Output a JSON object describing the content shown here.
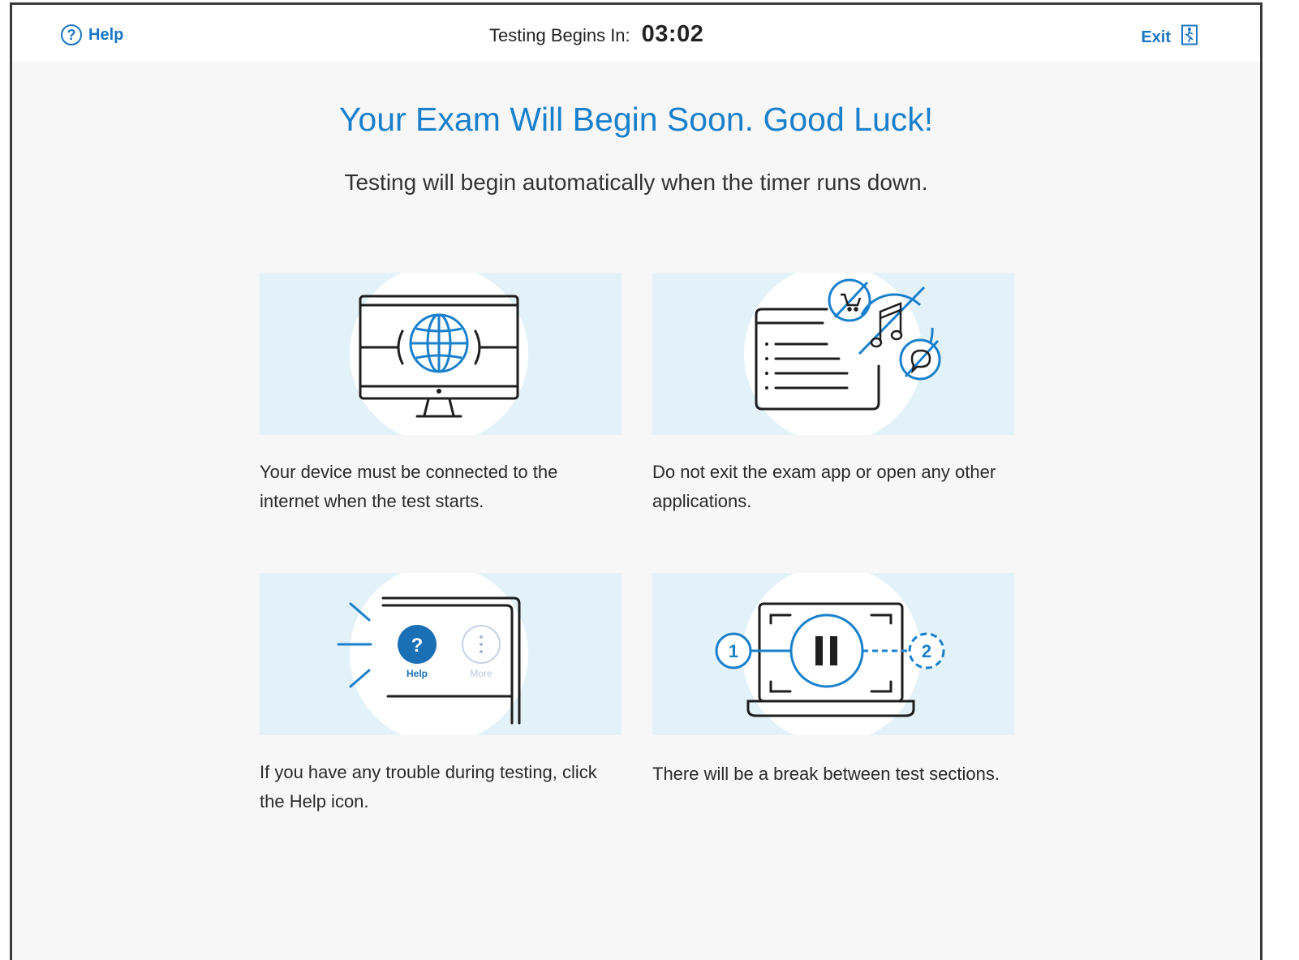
{
  "header": {
    "help_label": "Help",
    "timer_label": "Testing Begins In:",
    "timer_value": "03:02",
    "exit_label": "Exit"
  },
  "main": {
    "title": "Your Exam Will Begin Soon. Good Luck!",
    "subtitle": "Testing will begin automatically when the timer runs down."
  },
  "cards": [
    {
      "icon": "monitor-globe-icon",
      "caption": "Your device must be connected to the internet when the test starts."
    },
    {
      "icon": "no-other-apps-icon",
      "caption": "Do not exit the exam app or open any other applications."
    },
    {
      "icon": "help-button-illustration",
      "caption": "If you have any trouble during testing, click the Help icon.",
      "help_text": "Help",
      "more_text": "More"
    },
    {
      "icon": "section-break-icon",
      "caption": "There will be a break between test sections.",
      "step_1": "1",
      "step_2": "2"
    }
  ],
  "colors": {
    "accent": "#1a80cc",
    "illustration_bg": "#e3f1f8",
    "page_bg": "#f7f7f7"
  }
}
